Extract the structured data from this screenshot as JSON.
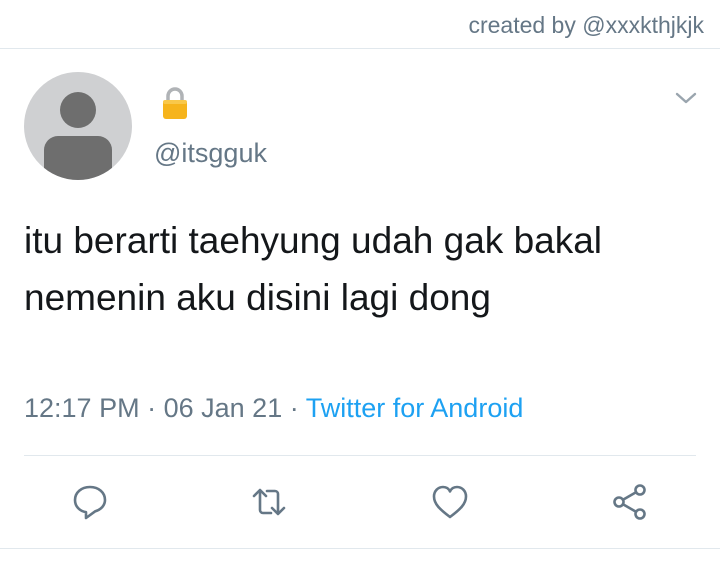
{
  "credit": "created by @xxxkthjkjk",
  "tweet": {
    "handle": "@itsgguk",
    "text": "itu berarti taehyung udah gak bakal nemenin aku disini lagi dong",
    "time": "12:17 PM",
    "date": "06 Jan 21",
    "separator": "·",
    "source": "Twitter for Android"
  },
  "icons": {
    "lock": "lock-icon",
    "more": "chevron-down-icon",
    "reply": "reply-icon",
    "retweet": "retweet-icon",
    "like": "heart-icon",
    "share": "share-icon"
  },
  "colors": {
    "link": "#1da1f2",
    "muted": "#657786",
    "lock": "#f4b400"
  }
}
